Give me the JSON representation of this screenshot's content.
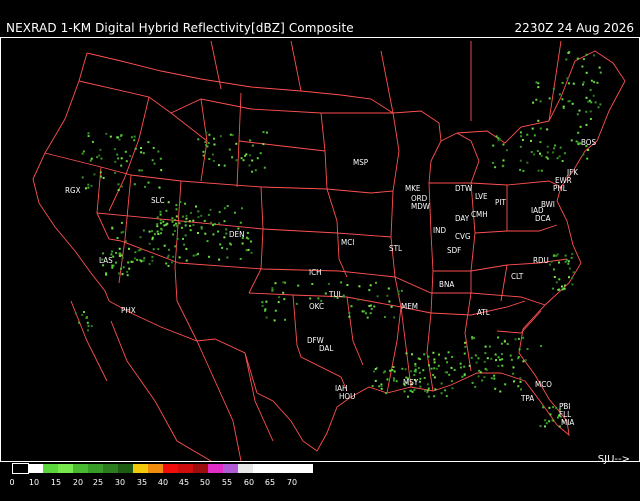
{
  "header": {
    "title": "NEXRAD 1-KM Digital Hybrid Reflectivity[dBZ] Composite",
    "timestamp": "2230Z 24 Aug 2026"
  },
  "legend": {
    "colors": [
      "#000000",
      "#ffffff",
      "#5bd63c",
      "#78e84f",
      "#49b931",
      "#389a27",
      "#2c7b1e",
      "#1d5b12",
      "#f2c90d",
      "#f28c0d",
      "#f20d0d",
      "#cf0d0d",
      "#9d0d0d",
      "#e02ec7",
      "#b25bd6",
      "#e7e7e7",
      "#ffffff"
    ],
    "labels": [
      "0",
      "10",
      "15",
      "20",
      "25",
      "30",
      "35",
      "40",
      "45",
      "50",
      "55",
      "60",
      "65",
      "70"
    ]
  },
  "footer": {
    "status": "SJU-->"
  },
  "map": {
    "border_color": "#ff5050",
    "cities": [
      {
        "code": "MSP"
      },
      {
        "code": "MKE"
      },
      {
        "code": "DTW"
      },
      {
        "code": "ORD"
      },
      {
        "code": "MDW"
      },
      {
        "code": "LVE"
      },
      {
        "code": "PIT"
      },
      {
        "code": "JFK"
      },
      {
        "code": "EWR"
      },
      {
        "code": "PHL"
      },
      {
        "code": "BOS"
      },
      {
        "code": "BWI"
      },
      {
        "code": "IAD"
      },
      {
        "code": "DCA"
      },
      {
        "code": "IND"
      },
      {
        "code": "DAY"
      },
      {
        "code": "CMH"
      },
      {
        "code": "CVG"
      },
      {
        "code": "SDF"
      },
      {
        "code": "STL"
      },
      {
        "code": "MCI"
      },
      {
        "code": "ICH"
      },
      {
        "code": "TUL"
      },
      {
        "code": "OKC"
      },
      {
        "code": "DFW"
      },
      {
        "code": "DAL"
      },
      {
        "code": "IAH"
      },
      {
        "code": "HOU"
      },
      {
        "code": "MSY"
      },
      {
        "code": "MEM"
      },
      {
        "code": "BNA"
      },
      {
        "code": "ATL"
      },
      {
        "code": "CLT"
      },
      {
        "code": "RDU"
      },
      {
        "code": "MCO"
      },
      {
        "code": "TPA"
      },
      {
        "code": "PBI"
      },
      {
        "code": "FLL"
      },
      {
        "code": "MIA"
      },
      {
        "code": "DEN"
      },
      {
        "code": "SLC"
      },
      {
        "code": "LAS"
      },
      {
        "code": "PHX"
      },
      {
        "code": "RGX"
      }
    ]
  }
}
